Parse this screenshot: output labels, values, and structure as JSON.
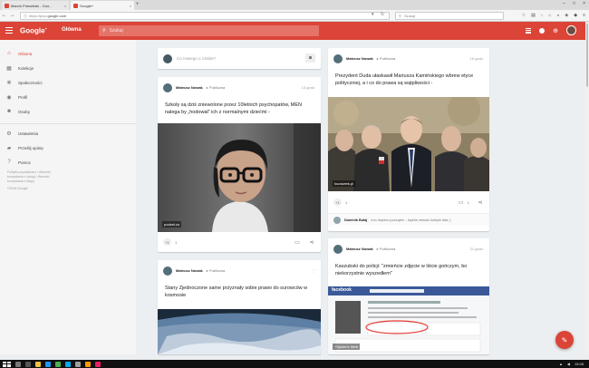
{
  "browser": {
    "tabs": [
      {
        "title": "Marcin Połosiński - Goo...",
        "active": false
      },
      {
        "title": "Google+",
        "active": true
      }
    ],
    "new_tab": "+",
    "url_base": "https://plus.",
    "url_domain": "google.com",
    "search_placeholder": "Szukaj"
  },
  "header": {
    "logo": "Google",
    "logo_sup": "+",
    "section": "Główna",
    "search_placeholder": "Szukaj",
    "accent": "#db4437"
  },
  "sidebar": {
    "items": [
      {
        "label": "Główna",
        "icon": "home-icon",
        "active": true
      },
      {
        "label": "Kolekcje",
        "icon": "collections-icon"
      },
      {
        "label": "Społeczności",
        "icon": "communities-icon"
      },
      {
        "label": "Profil",
        "icon": "profile-icon"
      },
      {
        "label": "Osoby",
        "icon": "people-icon"
      },
      {
        "label": "Ustawienia",
        "icon": "gear-icon"
      },
      {
        "label": "Prześlij opinię",
        "icon": "feedback-icon"
      },
      {
        "label": "Pomoc",
        "icon": "help-icon"
      }
    ],
    "footer_links": "Polityka prywatności • Warunki korzystania z usługi • Warunki korzystania z Mapy",
    "copyright": "©2016 Google"
  },
  "composer": {
    "placeholder": "Co nowego u Ciebie?"
  },
  "posts": [
    {
      "author": "Mateusz Nowak",
      "visibility": "Publiczna",
      "time": "13 godz.",
      "text": "Szkoły są dziś zniewolone przez 10letnich psychopatów, MEN nalega by „hodował” ich z normalnymi dziećmi -",
      "image_source": "pocket.co",
      "plus_count": "1"
    },
    {
      "author": "Mateusz Nowak",
      "visibility": "Publiczna",
      "time": "",
      "text": "Stany Zjednoczone same przyznały sobie prawo do surowców w kosmosie"
    },
    {
      "author": "Mateusz Nowak",
      "visibility": "Publiczna",
      "time": "16 godz.",
      "text": "Prezydent Duda ułaskawił Mariusza Kamińskiego wbrew etyce polityczniej, a i co do prawa są wątpliwości -",
      "image_source": "tocoweek.pl",
      "plus_count": "1",
      "comment_count": "1",
      "comment_author": "Dominik Bułaj",
      "comment_text": "a to dopiero początek... będzie wesoło kolejne lata ;)"
    },
    {
      "author": "Mateusz Nowak",
      "visibility": "Publiczna",
      "time": "21 godz.",
      "text": "Kaszubski do policji: \"zmieńcie zdjęcie w liście gończym, bo niekorzystnie wyszedłem\"",
      "image_source": "+Spider's Web",
      "fb_label": "facebook"
    }
  ],
  "taskbar": {
    "time": "15:08"
  }
}
